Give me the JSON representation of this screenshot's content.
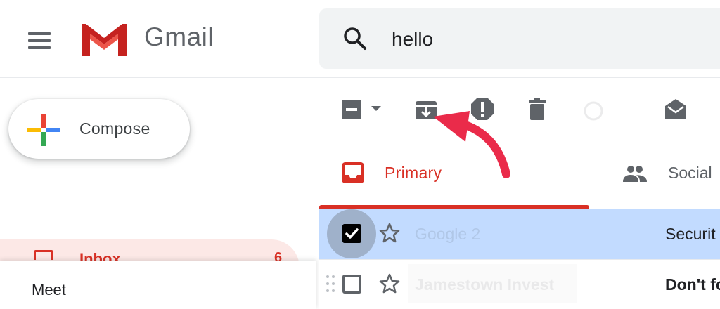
{
  "header": {
    "app_name": "Gmail",
    "search_value": "hello"
  },
  "sidebar": {
    "compose_label": "Compose",
    "inbox_label": "Inbox",
    "inbox_count": "6",
    "meet_label": "Meet"
  },
  "tabs": [
    {
      "label": "Primary",
      "active": true
    },
    {
      "label": "Social",
      "active": false
    }
  ],
  "emails": [
    {
      "sender": "Google 2",
      "subject": "Securit",
      "selected": true,
      "starred": false
    },
    {
      "sender": "Jamestown Invest",
      "subject": "Don't fo",
      "selected": false,
      "starred": false
    }
  ],
  "colors": {
    "accent_red": "#d93025",
    "selected_row": "#c2dbff",
    "icon_gray": "#5f6368",
    "arrow": "#ea2b4a"
  },
  "icons": {
    "menu": "hamburger-icon",
    "search": "search-icon",
    "archive": "archive-icon",
    "spam": "report-spam-icon",
    "delete": "trash-icon",
    "mark_read": "mark-as-read-icon"
  }
}
